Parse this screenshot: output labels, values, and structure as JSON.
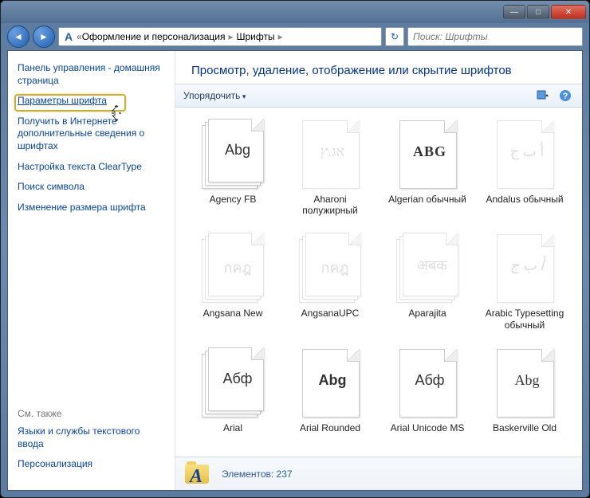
{
  "titlebar": {
    "minimize": "—",
    "maximize": "□",
    "close": "✕"
  },
  "nav": {
    "back": "◄",
    "forward": "►",
    "bc_icon": "A",
    "bc_chev": "«",
    "bc1": "Оформление и персонализация",
    "bc2": "Шрифты",
    "bc_arrow": "▸",
    "refresh": "↻",
    "search_placeholder": "Поиск: Шрифты"
  },
  "sidebar": {
    "home": "Панель управления - домашняя страница",
    "links": [
      "Параметры шрифта",
      "Получить в Интернете дополнительные сведения о шрифтах",
      "Настройка текста ClearType",
      "Поиск символа",
      "Изменение размера шрифта"
    ],
    "seealso_h": "См. также",
    "seealso": [
      "Языки и службы текстового ввода",
      "Персонализация"
    ]
  },
  "main": {
    "header": "Просмотр, удаление, отображение или скрытие шрифтов",
    "organize": "Упорядочить"
  },
  "fonts": [
    {
      "name": "Agency FB",
      "sample": "Abg",
      "stack": true,
      "dim": false,
      "style": "font-family:'Agency FB',sans-serif"
    },
    {
      "name": "Aharoni полужирный",
      "sample": "אג.ץ",
      "stack": false,
      "dim": true,
      "style": "font-family:Tahoma"
    },
    {
      "name": "Algerian обычный",
      "sample": "ABG",
      "stack": false,
      "dim": false,
      "style": "font-family:serif;font-weight:bold;letter-spacing:1px"
    },
    {
      "name": "Andalus обычный",
      "sample": "أ ب ج",
      "stack": false,
      "dim": true,
      "style": "font-family:Tahoma"
    },
    {
      "name": "Angsana New",
      "sample": "กคฎ",
      "stack": true,
      "dim": true,
      "style": "font-family:Tahoma"
    },
    {
      "name": "AngsanaUPC",
      "sample": "กคฎ",
      "stack": true,
      "dim": true,
      "style": "font-family:Tahoma"
    },
    {
      "name": "Aparajita",
      "sample": "अबक",
      "stack": true,
      "dim": true,
      "style": "font-family:Tahoma"
    },
    {
      "name": "Arabic Typesetting обычный",
      "sample": "أ ب ج",
      "stack": false,
      "dim": true,
      "style": "font-family:Tahoma;font-style:italic"
    },
    {
      "name": "Arial",
      "sample": "Абф",
      "stack": true,
      "dim": false,
      "style": "font-family:Arial"
    },
    {
      "name": "Arial Rounded",
      "sample": "Abg",
      "stack": false,
      "dim": false,
      "style": "font-family:'Arial Rounded MT Bold',Arial;font-weight:bold"
    },
    {
      "name": "Arial Unicode MS",
      "sample": "Абф",
      "stack": false,
      "dim": false,
      "style": "font-family:Arial"
    },
    {
      "name": "Baskerville Old",
      "sample": "Abg",
      "stack": false,
      "dim": false,
      "style": "font-family:Baskerville,Georgia,serif"
    }
  ],
  "status": {
    "label": "Элементов:",
    "count": "237"
  }
}
